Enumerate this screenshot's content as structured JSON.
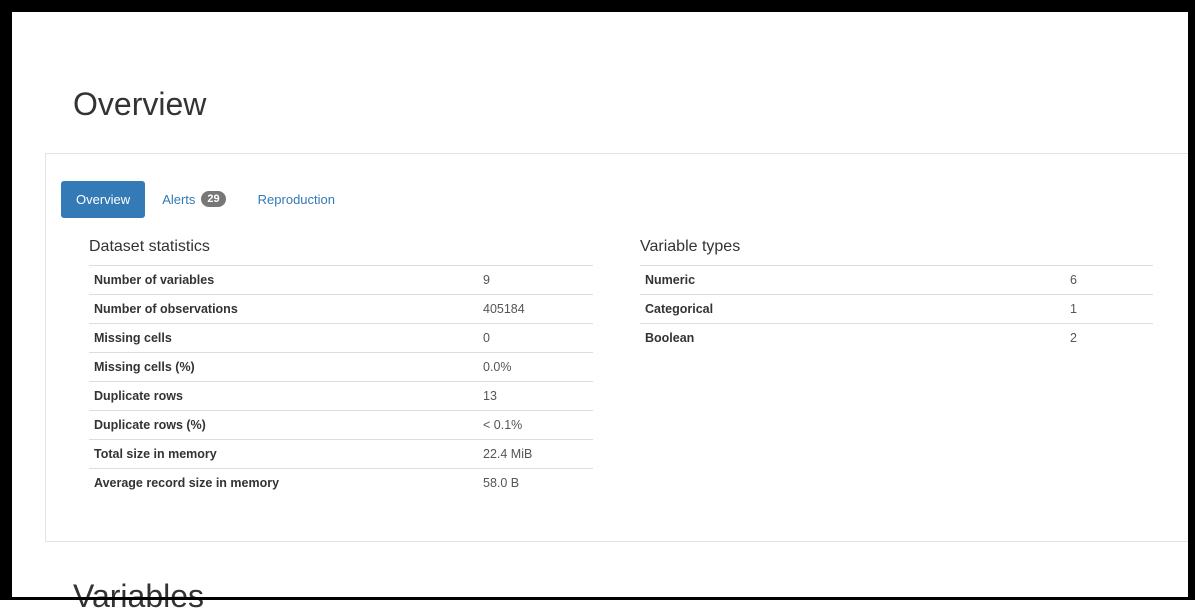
{
  "page_title": "Overview",
  "tabs": [
    {
      "label": "Overview"
    },
    {
      "label": "Alerts",
      "badge": "29"
    },
    {
      "label": "Reproduction"
    }
  ],
  "dataset_statistics": {
    "title": "Dataset statistics",
    "rows": [
      {
        "key": "Number of variables",
        "value": "9"
      },
      {
        "key": "Number of observations",
        "value": "405184"
      },
      {
        "key": "Missing cells",
        "value": "0"
      },
      {
        "key": "Missing cells (%)",
        "value": "0.0%"
      },
      {
        "key": "Duplicate rows",
        "value": "13"
      },
      {
        "key": "Duplicate rows (%)",
        "value": "< 0.1%"
      },
      {
        "key": "Total size in memory",
        "value": "22.4 MiB"
      },
      {
        "key": "Average record size in memory",
        "value": "58.0 B"
      }
    ]
  },
  "variable_types": {
    "title": "Variable types",
    "rows": [
      {
        "key": "Numeric",
        "value": "6"
      },
      {
        "key": "Categorical",
        "value": "1"
      },
      {
        "key": "Boolean",
        "value": "2"
      }
    ]
  },
  "next_section_title": "Variables",
  "colors": {
    "accent": "#337ab7",
    "badge": "#777777",
    "frame": "#000000"
  }
}
